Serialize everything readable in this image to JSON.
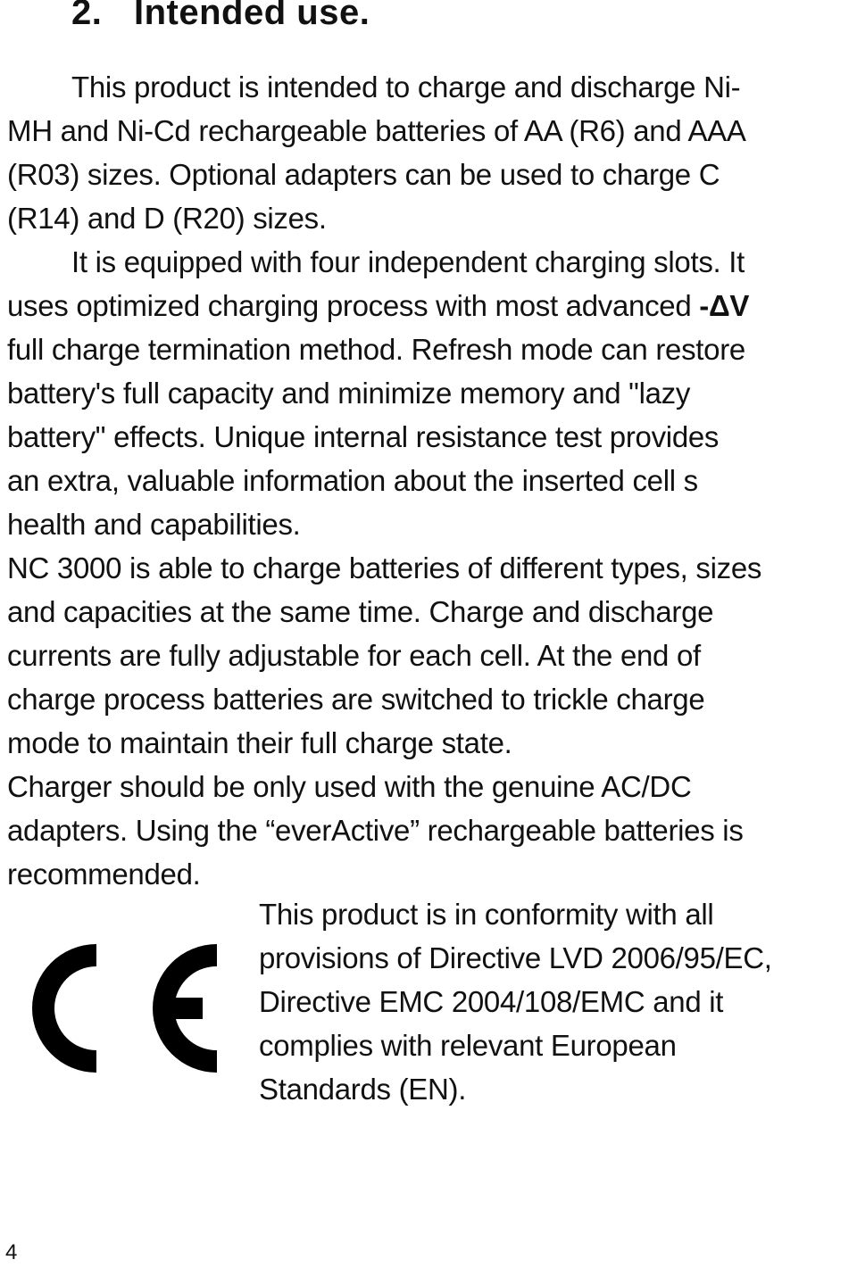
{
  "heading": {
    "number": "2.",
    "title": "Intended use."
  },
  "body_lines": [
    {
      "text": "This product is intended to charge and discharge Ni-",
      "indent": true
    },
    {
      "text": "MH and Ni-Cd rechargeable batteries of AA (R6) and AAA"
    },
    {
      "text": "(R03) sizes. Optional adapters can be used to charge C"
    },
    {
      "text": "(R14) and D (R20) sizes."
    },
    {
      "text": "It is equipped with four independent charging slots. It",
      "indent": true
    },
    {
      "text": "uses optimized charging process with most advanced ",
      "bold_suffix": "-ΔV"
    },
    {
      "text": "full charge termination method. Refresh mode can restore"
    },
    {
      "text": "battery's full capacity and minimize memory and \"lazy"
    },
    {
      "text": "battery\" effects. Unique internal resistance test provides"
    },
    {
      "text": "an extra, valuable information about the inserted cell s"
    },
    {
      "text": "health and capabilities."
    },
    {
      "text": "NC 3000 is able to charge batteries of different types, sizes"
    },
    {
      "text": "and capacities at the same time. Charge and discharge"
    },
    {
      "text": "currents are fully adjustable for each cell. At the end of"
    },
    {
      "text": "charge process batteries are switched to trickle charge"
    },
    {
      "text": "mode to maintain their full charge state."
    },
    {
      "text": "Charger should be only used with the genuine AC/DC"
    },
    {
      "text": "adapters. Using the “everActive” rechargeable batteries is"
    },
    {
      "text": "recommended."
    }
  ],
  "conformity_lines": [
    "This product is in conformity with all",
    "provisions of Directive LVD 2006/95/EC,",
    "Directive EMC 2004/108/EMC and it",
    "complies with relevant European",
    "Standards (EN)."
  ],
  "ce_mark": {
    "icon": "ce-mark-icon"
  },
  "page_number": "4"
}
